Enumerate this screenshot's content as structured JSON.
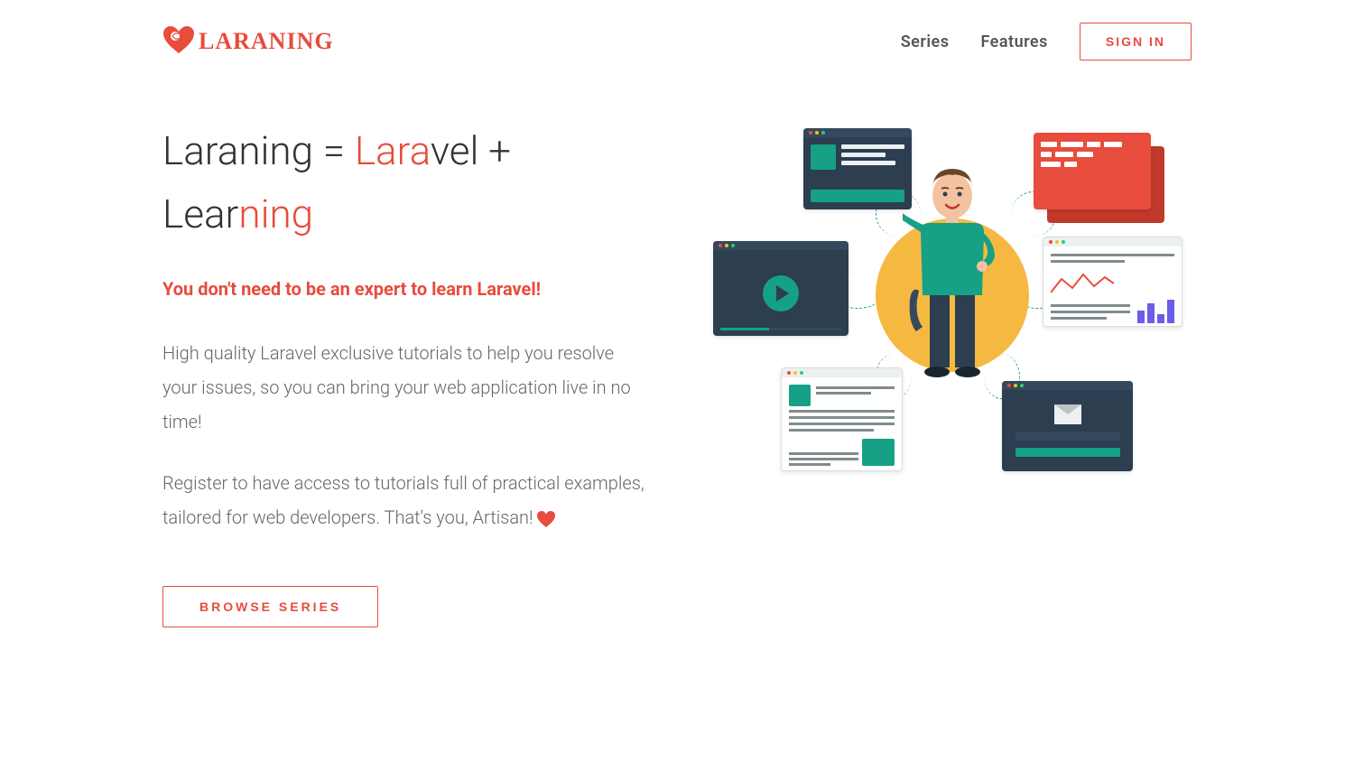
{
  "header": {
    "logo_text": "LARANING",
    "nav": {
      "series": "Series",
      "features": "Features"
    },
    "signin": "SIGN IN"
  },
  "hero": {
    "title_part1": "Laraning = ",
    "title_accent1": "Lara",
    "title_part2": "vel + Lear",
    "title_accent2": "ning",
    "subtitle": "You don't need to be an expert to learn Laravel!",
    "paragraph1": "High quality Laravel exclusive tutorials to help you resolve your issues, so you can bring your web application live in no time!",
    "paragraph2": "Register to have access to tutorials full of practical examples, tailored for web developers. That's you, Artisan!  ",
    "browse_button": "BROWSE SERIES"
  },
  "colors": {
    "accent": "#e74c3c",
    "dark": "#2c3e50",
    "teal": "#16a085"
  }
}
